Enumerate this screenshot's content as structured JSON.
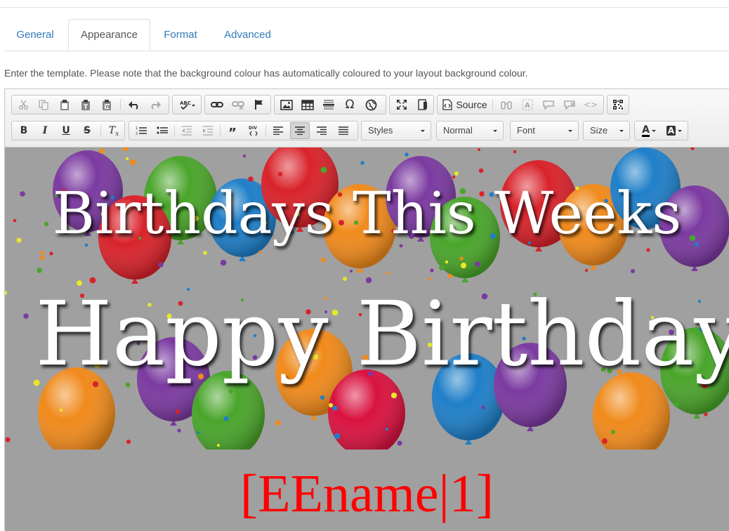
{
  "tabs": [
    {
      "label": "General",
      "active": false
    },
    {
      "label": "Appearance",
      "active": true
    },
    {
      "label": "Format",
      "active": false
    },
    {
      "label": "Advanced",
      "active": false
    }
  ],
  "instruction": "Enter the template. Please note that the background colour has automatically coloured to your layout background colour.",
  "toolbar": {
    "source_label": "Source",
    "styles": {
      "value": "Styles"
    },
    "format": {
      "value": "Normal"
    },
    "font": {
      "value": "Font"
    },
    "size": {
      "value": "Size"
    },
    "text_color_glyph": "A",
    "bg_color_glyph": "A"
  },
  "content": {
    "headline": "Birthdays This Weeks",
    "greeting": "Happy Birthday",
    "placeholder": "[EEname|1]",
    "background_color": "#a0a0a0",
    "placeholder_color": "#ff0000"
  }
}
